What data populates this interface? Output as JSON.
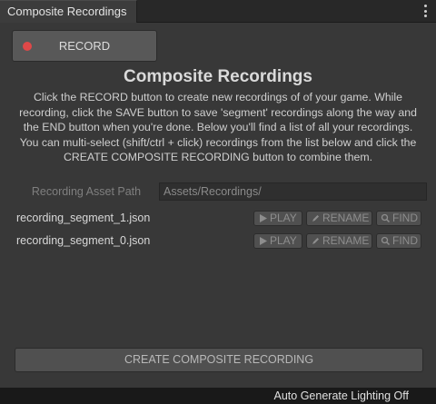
{
  "window": {
    "tab_title": "Composite Recordings"
  },
  "record_button": {
    "label": "RECORD"
  },
  "heading": "Composite Recordings",
  "description": "Click the RECORD button to create new recordings of of your game.  While recording, click the SAVE button to save 'segment' recordings along the way and the END button when you're done.  Below you'll find a list of all your recordings.  You can multi-select (shift/ctrl + click) recordings from the list below and click the CREATE COMPOSITE RECORDING button to combine them.",
  "asset_path": {
    "label": "Recording Asset Path",
    "value": "Assets/Recordings/"
  },
  "recordings": [
    {
      "name": "recording_segment_1.json",
      "play_label": "PLAY",
      "rename_label": "RENAME",
      "find_label": "FIND"
    },
    {
      "name": "recording_segment_0.json",
      "play_label": "PLAY",
      "rename_label": "RENAME",
      "find_label": "FIND"
    }
  ],
  "composite_button": {
    "label": "CREATE COMPOSITE RECORDING"
  },
  "status_bar": {
    "text": "Auto Generate Lighting Off"
  },
  "icons": {
    "record": "record-dot-icon",
    "play": "play-icon",
    "rename": "pencil-icon",
    "find": "magnifier-icon",
    "menu": "kebab-menu-icon"
  },
  "colors": {
    "record_dot": "#e04848",
    "panel_bg": "#383838",
    "status_bg": "#191919"
  }
}
